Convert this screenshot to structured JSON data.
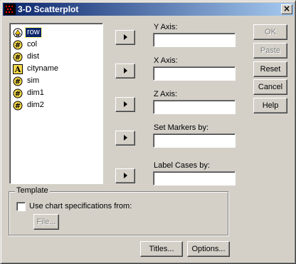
{
  "window": {
    "title": "3-D Scatterplot",
    "close_glyph": "×"
  },
  "variables": [
    {
      "label": "row",
      "type": "numeric-ordinal",
      "selected": true
    },
    {
      "label": "col",
      "type": "numeric"
    },
    {
      "label": "dist",
      "type": "numeric"
    },
    {
      "label": "cityname",
      "type": "string"
    },
    {
      "label": "sim",
      "type": "numeric"
    },
    {
      "label": "dim1",
      "type": "numeric"
    },
    {
      "label": "dim2",
      "type": "numeric"
    }
  ],
  "fields": {
    "y_axis": {
      "label": "Y Axis:",
      "value": ""
    },
    "x_axis": {
      "label": "X Axis:",
      "value": ""
    },
    "z_axis": {
      "label": "Z Axis:",
      "value": ""
    },
    "markers": {
      "label": "Set Markers by:",
      "value": ""
    },
    "label_cases": {
      "label": "Label Cases by:",
      "value": ""
    }
  },
  "buttons": {
    "ok": "OK",
    "paste": "Paste",
    "reset": "Reset",
    "cancel": "Cancel",
    "help": "Help",
    "titles": "Titles...",
    "options": "Options..."
  },
  "template": {
    "group_label": "Template",
    "checkbox_label": "Use chart specifications from:",
    "checked": false,
    "file_button": "File..."
  },
  "colors": {
    "face": "#d4d0c8",
    "title_start": "#0a246a",
    "title_end": "#a6caf0",
    "selection": "#0a246a"
  }
}
